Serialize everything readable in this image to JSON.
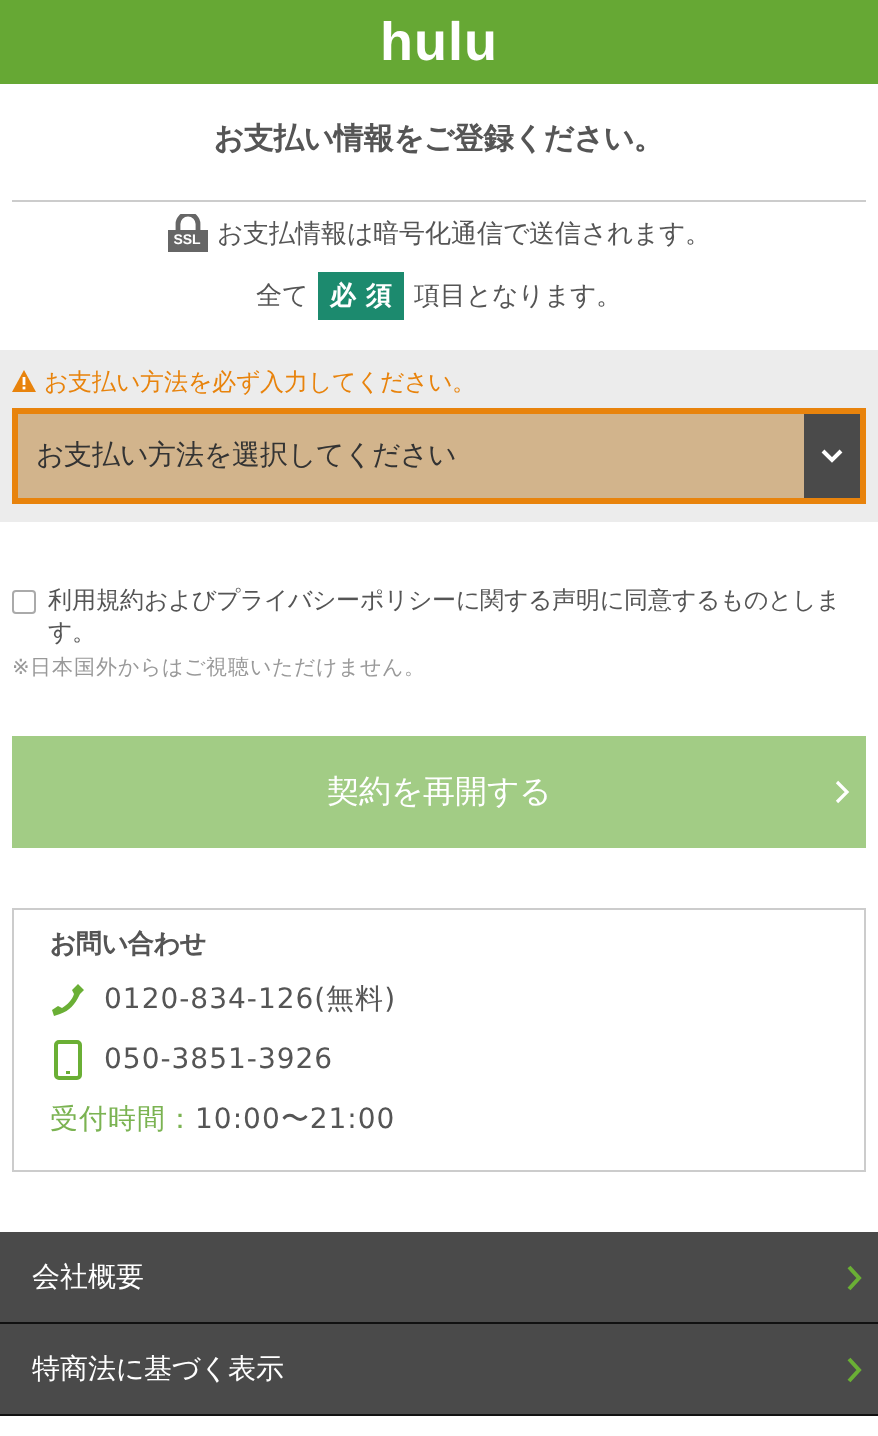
{
  "header": {
    "logo": "hulu"
  },
  "title": "お支払い情報をご登録ください。",
  "notices": {
    "ssl_badge": "SSL",
    "ssl_text": "お支払情報は暗号化通信で送信されます。",
    "required_before": "全て",
    "required_badge": "必 須",
    "required_after": "項目となります。"
  },
  "payment": {
    "error": "お支払い方法を必ず入力してください。",
    "select": {
      "value": "お支払い方法を選択してください",
      "invalid": true
    }
  },
  "agreement": {
    "label": "利用規約およびプライバシーポリシーに関する声明に同意するものとします。",
    "checked": false
  },
  "note": "※日本国外からはご視聴いただけません。",
  "submit": {
    "label": "契約を再開する",
    "disabled": true
  },
  "contact": {
    "title": "お問い合わせ",
    "lines": [
      {
        "kind": "phone",
        "text": "0120-834-126(無料)"
      },
      {
        "kind": "mobile",
        "text": "050-3851-3926"
      }
    ],
    "hours_label": "受付時間：",
    "hours": "10:00〜21:00"
  },
  "footer_links": [
    "会社概要",
    "特商法に基づく表示"
  ]
}
